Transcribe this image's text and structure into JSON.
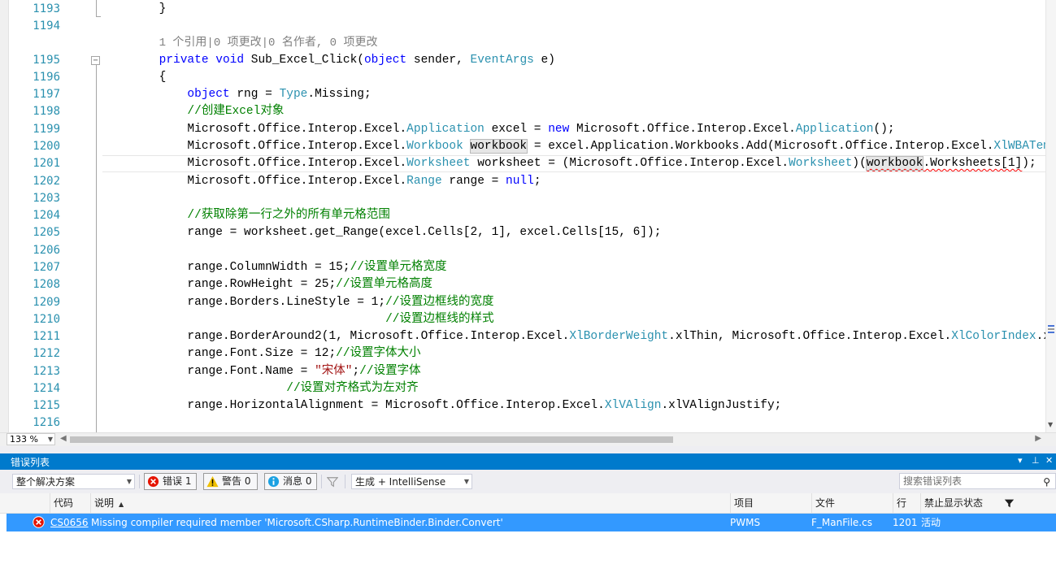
{
  "editor": {
    "line_numbers": [
      "1193",
      "1194",
      "",
      "1195",
      "1196",
      "1197",
      "1198",
      "1199",
      "1200",
      "1201",
      "1202",
      "1203",
      "1204",
      "1205",
      "1206",
      "1207",
      "1208",
      "1209",
      "1210",
      "1211",
      "1212",
      "1213",
      "1214",
      "1215",
      "1216"
    ],
    "code": {
      "l1193": "}",
      "codelens": "1 个引用|0 项更改|0 名作者, 0 项更改",
      "l1195_kw": "private void",
      "l1195_a": " Sub_Excel_Click(",
      "l1195_kw2": "object",
      "l1195_b": " sender, ",
      "l1195_ty": "EventArgs",
      "l1195_c": " e)",
      "l1196": "{",
      "l1197_kw": "object",
      "l1197_a": " rng = ",
      "l1197_ty": "Type",
      "l1197_b": ".Missing;",
      "l1198_cm": "//创建Excel对象",
      "l1199_a": "Microsoft.Office.Interop.Excel.",
      "l1199_ty": "Application",
      "l1199_b": " excel = ",
      "l1199_kw": "new",
      "l1199_c": " Microsoft.Office.Interop.Excel.",
      "l1199_ty2": "Application",
      "l1199_d": "();",
      "l1200_a": "Microsoft.Office.Interop.Excel.",
      "l1200_ty": "Workbook",
      "l1200_hl": "workbook",
      "l1200_b": " = excel.Application.Workbooks.Add(Microsoft.Office.Interop.Excel.",
      "l1200_ty2": "XlWBATemp",
      "l1201_a": "Microsoft.Office.Interop.Excel.",
      "l1201_ty": "Worksheet",
      "l1201_b": " worksheet = (Microsoft.Office.Interop.Excel.",
      "l1201_ty2": "Worksheet",
      "l1201_c": ")(",
      "l1201_hl": "workbook",
      "l1201_d": ".Worksheets[1]",
      "l1201_e": ");",
      "l1202_a": "Microsoft.Office.Interop.Excel.",
      "l1202_ty": "Range",
      "l1202_b": " range = ",
      "l1202_kw": "null",
      "l1202_c": ";",
      "l1204_cm": "//获取除第一行之外的所有单元格范围",
      "l1205": "range = worksheet.get_Range(excel.Cells[2, 1], excel.Cells[15, 6]);",
      "l1207_a": "range.ColumnWidth = 15;",
      "l1207_cm": "//设置单元格宽度",
      "l1208_a": "range.RowHeight = 25;",
      "l1208_cm": "//设置单元格高度",
      "l1209_a": "range.Borders.LineStyle = 1;",
      "l1209_cm": "//设置边框线的宽度",
      "l1210_cm": "//设置边框线的样式",
      "l1211_a": "range.BorderAround2(1, Microsoft.Office.Interop.Excel.",
      "l1211_ty": "XlBorderWeight",
      "l1211_b": ".xlThin, Microsoft.Office.Interop.Excel.",
      "l1211_ty2": "XlColorIndex",
      "l1211_c": ".xl",
      "l1212_a": "range.Font.Size = 12;",
      "l1212_cm": "//设置字体大小",
      "l1213_a": "range.Font.Name = ",
      "l1213_st": "\"宋体\"",
      "l1213_b": ";",
      "l1213_cm": "//设置字体",
      "l1214_cm": "//设置对齐格式为左对齐",
      "l1215_a": "range.HorizontalAlignment = Microsoft.Office.Interop.Excel.",
      "l1215_ty": "XlVAlign",
      "l1215_b": ".xlVAlignJustify;"
    },
    "zoom": "133 %"
  },
  "error_list": {
    "title": "错误列表",
    "title_controls": [
      "▾",
      "⊥",
      "✕"
    ],
    "scope": "整个解决方案",
    "errors_btn": "错误 1",
    "warnings_btn": "警告 0",
    "messages_btn": "消息 0",
    "build_filter": "生成 + IntelliSense",
    "search_placeholder": "搜索错误列表",
    "columns": {
      "code": "代码",
      "description": "说明",
      "project": "项目",
      "file": "文件",
      "line": "行",
      "suppression": "禁止显示状态"
    },
    "rows": [
      {
        "code": "CS0656",
        "description": "Missing compiler required member 'Microsoft.CSharp.RuntimeBinder.Binder.Convert'",
        "project": "PWMS",
        "file": "F_ManFile.cs",
        "line": "1201",
        "state": "活动"
      }
    ]
  },
  "colors": {
    "accent": "#007acc",
    "selection": "#3399ff",
    "keyword": "#0000ff",
    "type": "#2b91af",
    "comment": "#008000",
    "string": "#a31515"
  }
}
